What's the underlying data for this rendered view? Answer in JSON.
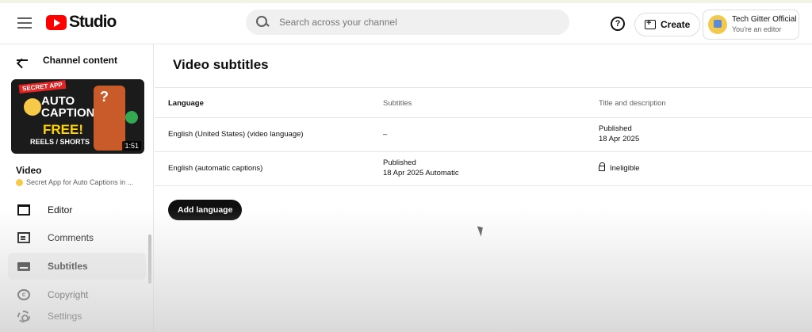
{
  "topbar": {
    "logo_text": "Studio",
    "search_placeholder": "Search across your channel",
    "help_symbol": "?",
    "create_label": "Create",
    "account": {
      "name": "Tech Gitter Official",
      "role": "You're an editor"
    }
  },
  "sidebar": {
    "back_label": "Channel content",
    "thumbnail": {
      "badge": "SECRET APP",
      "title_line1": "AUTO",
      "title_line2": "CAPTIONS",
      "free": "FREE!",
      "reels": "REELS / SHORTS",
      "question": "?",
      "duration": "1:51"
    },
    "video_label": "Video",
    "video_title": "Secret App for Auto Captions in ...",
    "nav": {
      "editor": "Editor",
      "comments": "Comments",
      "subtitles": "Subtitles",
      "copyright": "Copyright",
      "copyright_symbol": "c",
      "settings": "Settings"
    }
  },
  "main": {
    "title": "Video subtitles",
    "columns": {
      "language": "Language",
      "subtitles": "Subtitles",
      "title_desc": "Title and description"
    },
    "rows": [
      {
        "language": "English (United States) (video language)",
        "subtitles": "–",
        "title_status": "Published",
        "title_date": "18 Apr 2025"
      },
      {
        "language": "English (automatic captions)",
        "subtitles_status": "Published",
        "subtitles_date": "18 Apr 2025 Automatic",
        "title_status": "Ineligible"
      }
    ],
    "add_language_label": "Add language"
  },
  "colors": {
    "brand_red": "#ff0000",
    "text_primary": "#0f0f0f",
    "text_secondary": "#606060",
    "button_dark": "#0f0f0f"
  }
}
